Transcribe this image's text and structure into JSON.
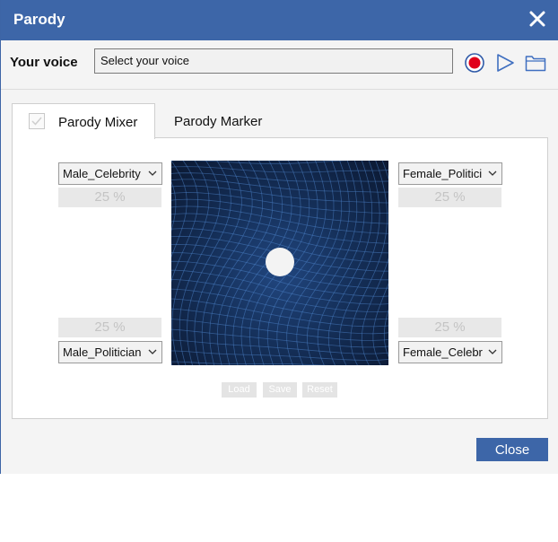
{
  "window": {
    "title": "Parody"
  },
  "voice": {
    "label": "Your voice",
    "value": "Select your voice"
  },
  "tabs": [
    {
      "label": "Parody Mixer",
      "active": true
    },
    {
      "label": "Parody Marker",
      "active": false
    }
  ],
  "mixer": {
    "top_left": {
      "voice": "Male_Celebrity",
      "percent": "25 %"
    },
    "top_right": {
      "voice": "Female_Politici",
      "percent": "25 %"
    },
    "bottom_left": {
      "voice": "Male_Politician",
      "percent": "25 %"
    },
    "bottom_right": {
      "voice": "Female_Celebr",
      "percent": "25 %"
    }
  },
  "mixer_buttons": {
    "load": "Load",
    "save": "Save",
    "reset": "Reset"
  },
  "footer": {
    "close_label": "Close"
  },
  "colors": {
    "accent": "#3d66a8",
    "record": "#e0001a",
    "grid_line": "#4a80c4"
  },
  "icons": [
    "close-icon",
    "record-icon",
    "play-icon",
    "folder-icon",
    "checkbox-icon",
    "chevron-down-icon"
  ]
}
